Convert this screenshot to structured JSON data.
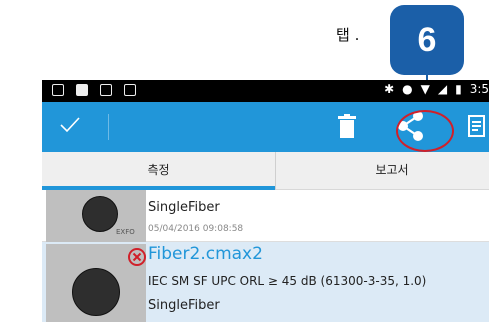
{
  "instruction": {
    "text": "탭 .",
    "step_number": "6"
  },
  "actionbar": {
    "check_icon": "check-icon",
    "delete_icon": "trash-icon",
    "share_icon": "share-icon",
    "report_icon": "report-icon",
    "accent": "#2196d9"
  },
  "statusbar": {
    "time": "3:5"
  },
  "tabs": [
    {
      "label": "측정",
      "active": true
    },
    {
      "label": "보고서",
      "active": false
    }
  ],
  "list": [
    {
      "name": "SingleFiber",
      "date": "05/04/2016 09:08:58",
      "watermark": "EXFO"
    },
    {
      "title": "Fiber2.cmax2",
      "spec": "IEC SM SF UPC ORL ≥ 45 dB (61300-3-35, 1.0)",
      "name": "SingleFiber",
      "status": "fail"
    }
  ],
  "colors": {
    "callout_badge": "#1b5fa8",
    "callout_circle": "#d0202a",
    "selected_row": "#dceaf6"
  }
}
